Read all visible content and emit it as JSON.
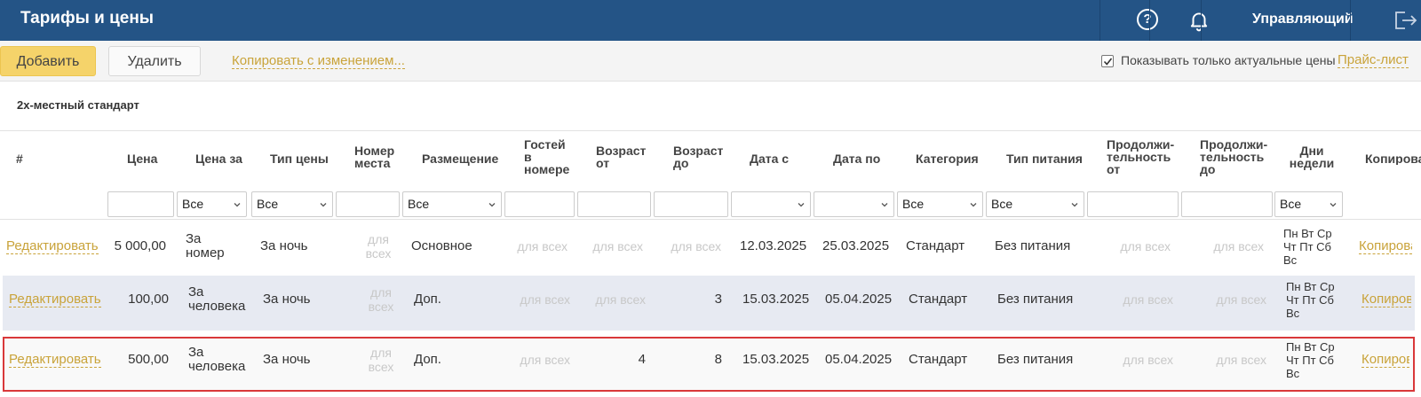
{
  "header": {
    "title": "Тарифы и цены",
    "help_icon_glyph": "?",
    "user_label": "Управляющий"
  },
  "toolbar": {
    "add_label": "Добавить",
    "delete_label": "Удалить",
    "copy_label": "Копировать с изменением...",
    "only_actual_checked": true,
    "only_actual_label": "Показывать только актуальные цены",
    "price_list_label": "Прайс-лист"
  },
  "room_title": "2х-местный стандарт",
  "columns": {
    "num": "#",
    "price": "Цена",
    "price_for": "Цена за",
    "price_type": "Тип цены",
    "place_no": "Номер места",
    "placement": "Размещение",
    "guests": "Гостей в номере",
    "age_from": "Возраст от",
    "age_to": "Возраст до",
    "date_from": "Дата с",
    "date_to": "Дата по",
    "category": "Категория",
    "meal": "Тип питания",
    "dur_from": "Продолжи- тельность от",
    "dur_to": "Продолжи- тельность до",
    "weekdays": "Дни недели",
    "copy": "Копировать"
  },
  "filters": {
    "price_for": "Все",
    "price_type": "Все",
    "placement": "Все",
    "category": "Все",
    "meal": "Все",
    "weekdays": "Все"
  },
  "rows": [
    {
      "edit": "Редактировать",
      "price": "5 000,00",
      "price_for": "За номер",
      "price_type": "За ночь",
      "place_no": "для всех",
      "placement": "Основное",
      "guests": "для всех",
      "age_from": "для всех",
      "age_to": "для всех",
      "date_from": "12.03.2025",
      "date_to": "25.03.2025",
      "category": "Стандарт",
      "meal": "Без питания",
      "dur_from": "для всех",
      "dur_to": "для всех",
      "weekdays": "Пн Вт Ср Чт Пт Сб Вс",
      "copy": "Копировать"
    },
    {
      "edit": "Редактировать",
      "price": "100,00",
      "price_for": "За человека",
      "price_type": "За ночь",
      "place_no": "для всех",
      "placement": "Доп.",
      "guests": "для всех",
      "age_from": "для всех",
      "age_to": "3",
      "date_from": "15.03.2025",
      "date_to": "05.04.2025",
      "category": "Стандарт",
      "meal": "Без питания",
      "dur_from": "для всех",
      "dur_to": "для всех",
      "weekdays": "Пн Вт Ср Чт Пт Сб Вс",
      "copy": "Копировать"
    },
    {
      "edit": "Редактировать",
      "price": "500,00",
      "price_for": "За человека",
      "price_type": "За ночь",
      "place_no": "для всех",
      "placement": "Доп.",
      "guests": "для всех",
      "age_from": "4",
      "age_to": "8",
      "date_from": "15.03.2025",
      "date_to": "05.04.2025",
      "category": "Стандарт",
      "meal": "Без питания",
      "dur_from": "для всех",
      "dur_to": "для всех",
      "weekdays": "Пн Вт Ср Чт Пт Сб Вс",
      "copy": "Копировать"
    }
  ],
  "colors": {
    "header_bg": "#245486",
    "accent_link": "#c9a33a",
    "add_button": "#f5d36a",
    "selected_row_border": "#d9383a",
    "alt_row_bg": "#e7eaf2"
  }
}
